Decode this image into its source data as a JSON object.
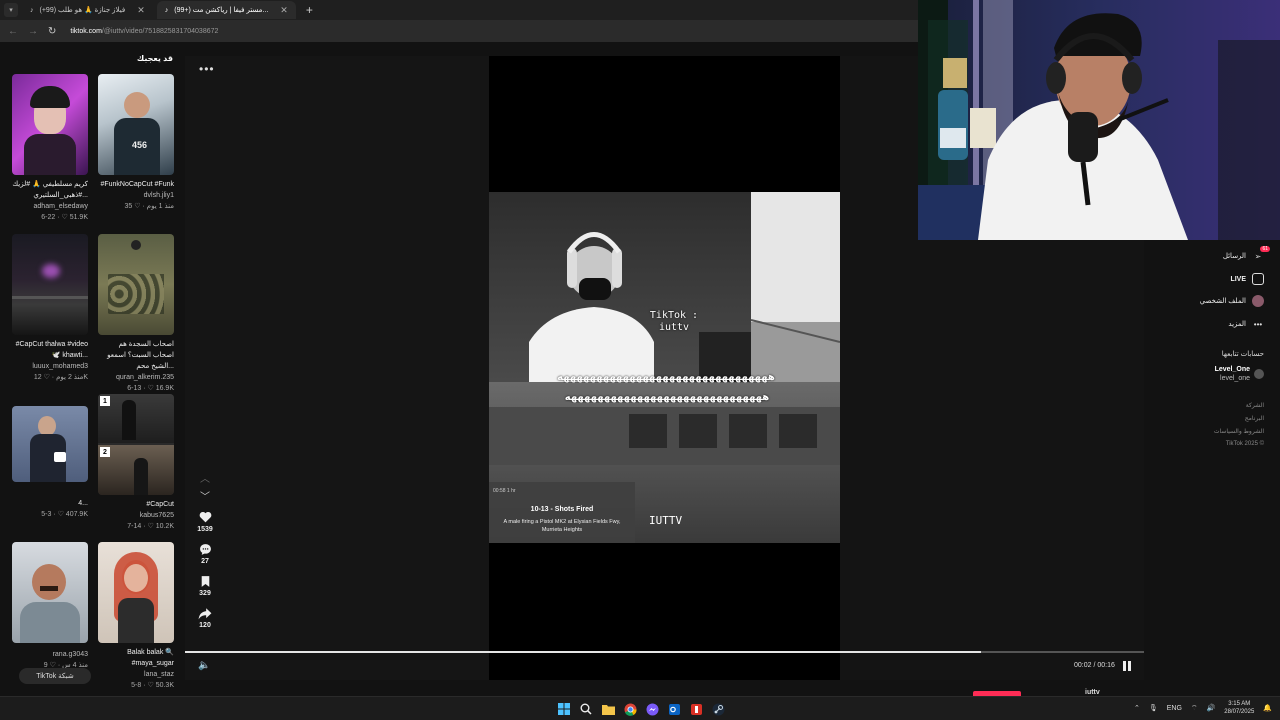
{
  "browser": {
    "tabs": [
      {
        "label": "فيلاز جنازة 🙏 هو طلب (99+)",
        "active": false
      },
      {
        "label": "(99+) مستر فيفا | رياكشن مت...",
        "active": true
      }
    ],
    "new_tab": "+",
    "url_domain": "tiktok.com",
    "url_path": "/@iuttv/video/7518825831704038672"
  },
  "left_panel": {
    "title": "قد يعجبك",
    "cards": [
      {
        "caption": "كريم مسلطيفي 🙏 #لزيك #ذهبي_السلتيري...",
        "user": "adham_elsedawy",
        "stats": "6-22 · ♡ 51.9K"
      },
      {
        "caption": "#FunkNoCapCut #Funk",
        "user": "dvlsh.jliy1",
        "stats": "منذ 1 يوم · ♡ 35"
      },
      {
        "caption": "#CapCut thalwa #video 🕊️ khawti...",
        "user": "luuux_mohamed3",
        "stats": "منذ 2 يوم · ♡ 12K"
      },
      {
        "caption": "اصحاب السجدة هم اصحاب السبت؟ اسمعو الشيخ محم...",
        "user": "quran_alkerim.235",
        "stats": "6-13 · ♡ 16.9K"
      },
      {
        "caption": "4...",
        "user": "",
        "stats": "5-3 · ♡ 407.9K"
      },
      {
        "caption": "#CapCut",
        "user": "kabus7625",
        "stats": "7-14 · ♡ 10.2K"
      },
      {
        "caption": "",
        "user": "rana.g3043",
        "stats": "منذ 4 س · ♡ 9"
      },
      {
        "caption": "Balak balak 🔍 #maya_sugar",
        "user": "lana_staz",
        "stats": "5-8 · ♡ 50.3K"
      }
    ],
    "pill": "TikTok شبكة"
  },
  "player": {
    "more": "•••",
    "video": {
      "watermark": "TikTok : iuttv",
      "overlay_text": "ههههههههههههههههههههههههههههههههه",
      "overlay_text2": "ههههههههههههههههههههههههههههههه",
      "card_title": "10-13 - Shots Fired",
      "card_body": "A male firing a Pistol MK2 at Elysian Fields Fwy, Murrieta Heights",
      "card_small": "00:58   1 hr",
      "brand": "IUTTV"
    },
    "actions": {
      "likes": "1539",
      "comments": "27",
      "saves": "329",
      "shares": "120"
    },
    "time": "00:02 / 00:16",
    "progress_fraction": 0.83
  },
  "right_panel": {
    "nav": [
      {
        "label": "الرسائل",
        "icon": "send-icon",
        "badge": "61"
      },
      {
        "label": "LIVE",
        "icon": "live-icon"
      },
      {
        "label": "الملف الشخصي",
        "icon": "profile-icon"
      },
      {
        "label": "المزيد",
        "icon": "more-icon"
      }
    ],
    "following_title": "حسابات تتابعها",
    "following": [
      {
        "name": "Level_One",
        "handle": "level_one"
      }
    ],
    "footer": [
      "الشركة",
      "البرنامج",
      "الشروط والسياسات",
      "TikTok 2025 ©"
    ]
  },
  "bottom": {
    "user": "iuttv"
  },
  "taskbar": {
    "lang": "ENG",
    "time": "3:15 AM",
    "date": "28/07/2025"
  },
  "colors": {
    "accent": "#fe2c55",
    "bg": "#121212"
  }
}
